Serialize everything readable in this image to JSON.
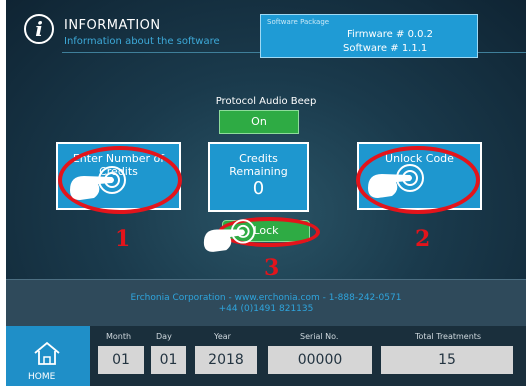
{
  "header": {
    "title": "INFORMATION",
    "subtitle": "Information about the software",
    "info_icon": "i"
  },
  "software_package": {
    "label": "Software Package",
    "firmware": "Firmware # 0.0.2",
    "software": "Software # 1.1.1"
  },
  "controls": {
    "audio_beep_label": "Protocol Audio Beep",
    "audio_beep_button": "On",
    "enter_credits_label": "Enter Number of Credits",
    "credits_remaining_label": "Credits Remaining",
    "credits_remaining_value": "0",
    "unlock_label": "Unlock Code",
    "lock_button": "Lock"
  },
  "annotations": [
    "1",
    "2",
    "3"
  ],
  "footer": {
    "company_line": "Erchonia Corporation - www.erchonia.com - 1-888-242-0571",
    "phone_line": "+44 (0)1491 821135",
    "home_label": "HOME",
    "fields": [
      {
        "label": "Month",
        "value": "01"
      },
      {
        "label": "Day",
        "value": "01"
      },
      {
        "label": "Year",
        "value": "2018"
      },
      {
        "label": "Serial No.",
        "value": "00000"
      },
      {
        "label": "Total Treatments",
        "value": "15"
      }
    ]
  },
  "colors": {
    "accent_blue": "#1e97cf",
    "green": "#2eab44",
    "annotation_red": "#e3141b",
    "background": "#1a3a4c"
  },
  "icons": [
    "info-icon",
    "home-icon",
    "hand-pointer-icon"
  ]
}
